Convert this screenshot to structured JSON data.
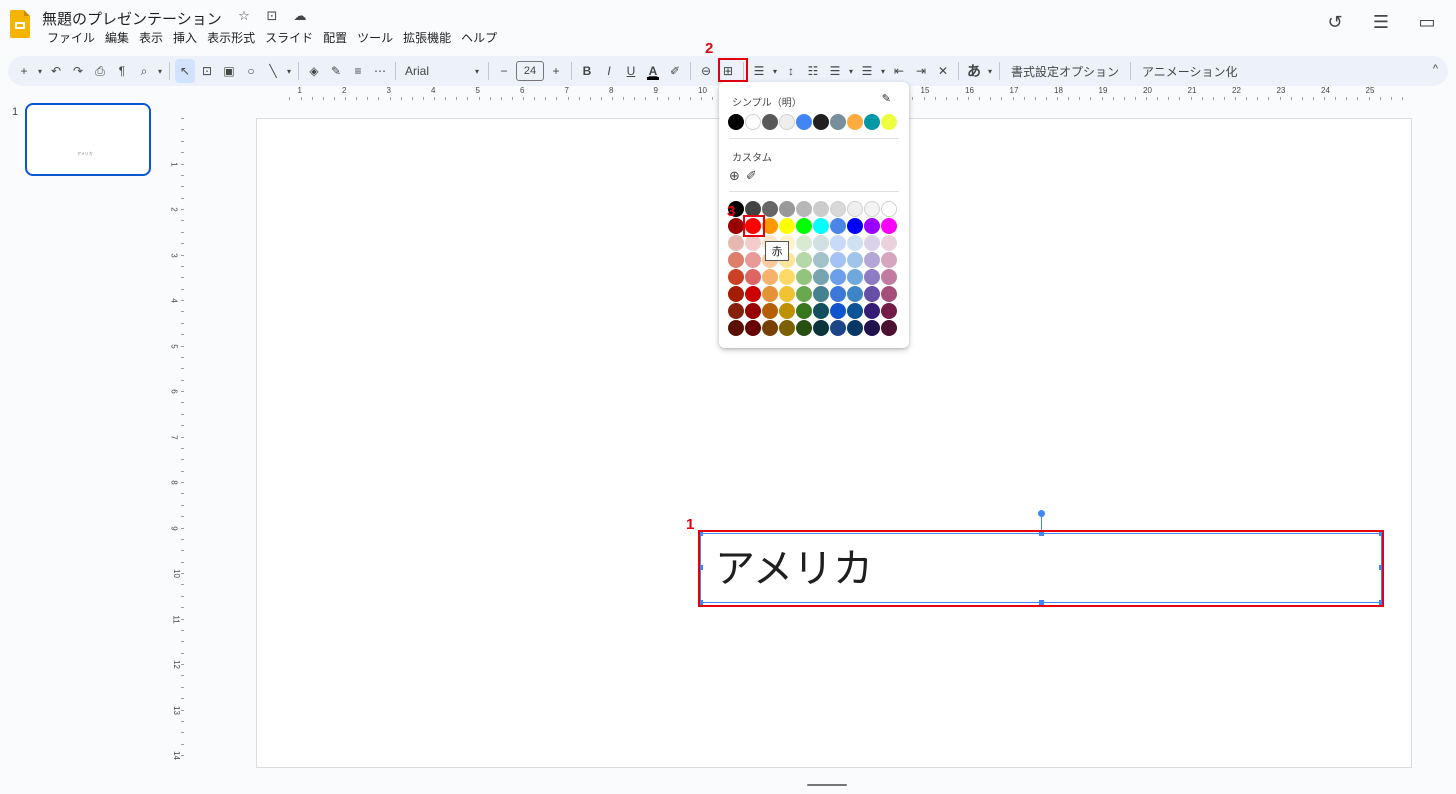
{
  "app": {
    "title": "無題のプレゼンテーション",
    "title_icons": [
      "☆",
      "⊡",
      "☁"
    ],
    "menu": [
      "ファイル",
      "編集",
      "表示",
      "挿入",
      "表示形式",
      "スライド",
      "配置",
      "ツール",
      "拡張機能",
      "ヘルプ"
    ],
    "top_right_icons": [
      "history-icon",
      "comments-icon",
      "meet-icon"
    ]
  },
  "toolbar": {
    "font": "Arial",
    "font_size": "24",
    "bold": "B",
    "italic": "I",
    "underline": "U",
    "text_color": "A",
    "highlight_char": "あ",
    "format_options": "書式設定オプション",
    "animation": "アニメーション化"
  },
  "ruler": {
    "h_numbers": [
      "1",
      "2",
      "3",
      "4",
      "5",
      "6",
      "7",
      "8",
      "9",
      "10",
      "11",
      "12",
      "13",
      "14",
      "15",
      "16",
      "17",
      "18",
      "19",
      "20",
      "21",
      "22",
      "23",
      "24",
      "25"
    ],
    "v_numbers": [
      "1",
      "2",
      "3",
      "4",
      "5",
      "6",
      "7",
      "8",
      "9",
      "10",
      "11",
      "12",
      "13",
      "14"
    ]
  },
  "filmstrip": {
    "slide_number": "1",
    "thumb_text": "アメリカ"
  },
  "slide": {
    "text": "アメリカ"
  },
  "color_popup": {
    "theme_label": "シンプル（明）",
    "custom_label": "カスタム",
    "theme_colors": [
      "#000000",
      "#ffffff",
      "#595959",
      "#eeeeee",
      "#4285f4",
      "#212121",
      "#78909c",
      "#ffab40",
      "#0097a7",
      "#eeff41"
    ],
    "grid": [
      [
        "#000000",
        "#434343",
        "#666666",
        "#999999",
        "#b7b7b7",
        "#cccccc",
        "#d9d9d9",
        "#efefef",
        "#f3f3f3",
        "#ffffff"
      ],
      [
        "#980000",
        "#ff0000",
        "#ff9900",
        "#ffff00",
        "#00ff00",
        "#00ffff",
        "#4a86e8",
        "#0000ff",
        "#9900ff",
        "#ff00ff"
      ],
      [
        "#e6b8af",
        "#f4cccc",
        "#fce5cd",
        "#fff2cc",
        "#d9ead3",
        "#d0e0e3",
        "#c9daf8",
        "#cfe2f3",
        "#d9d2e9",
        "#ead1dc"
      ],
      [
        "#dd7e6b",
        "#ea9999",
        "#f9cb9c",
        "#ffe599",
        "#b6d7a8",
        "#a2c4c9",
        "#a4c2f4",
        "#9fc5e8",
        "#b4a7d6",
        "#d5a6bd"
      ],
      [
        "#cc4125",
        "#e06666",
        "#f6b26b",
        "#ffd966",
        "#93c47d",
        "#76a5af",
        "#6d9eeb",
        "#6fa8dc",
        "#8e7cc3",
        "#c27ba0"
      ],
      [
        "#a61c00",
        "#cc0000",
        "#e69138",
        "#f1c232",
        "#6aa84f",
        "#45818e",
        "#3c78d8",
        "#3d85c6",
        "#674ea7",
        "#a64d79"
      ],
      [
        "#85200c",
        "#990000",
        "#b45f06",
        "#bf9000",
        "#38761d",
        "#134f5c",
        "#1155cc",
        "#0b5394",
        "#351c75",
        "#741b47"
      ],
      [
        "#5b0f00",
        "#660000",
        "#783f04",
        "#7f6000",
        "#274e13",
        "#0c343d",
        "#1c4587",
        "#073763",
        "#20124d",
        "#4c1130"
      ]
    ],
    "tooltip": "赤"
  },
  "annotations": {
    "mark1": "1",
    "mark2": "2",
    "mark3": "3",
    "color": "#e5000e"
  }
}
